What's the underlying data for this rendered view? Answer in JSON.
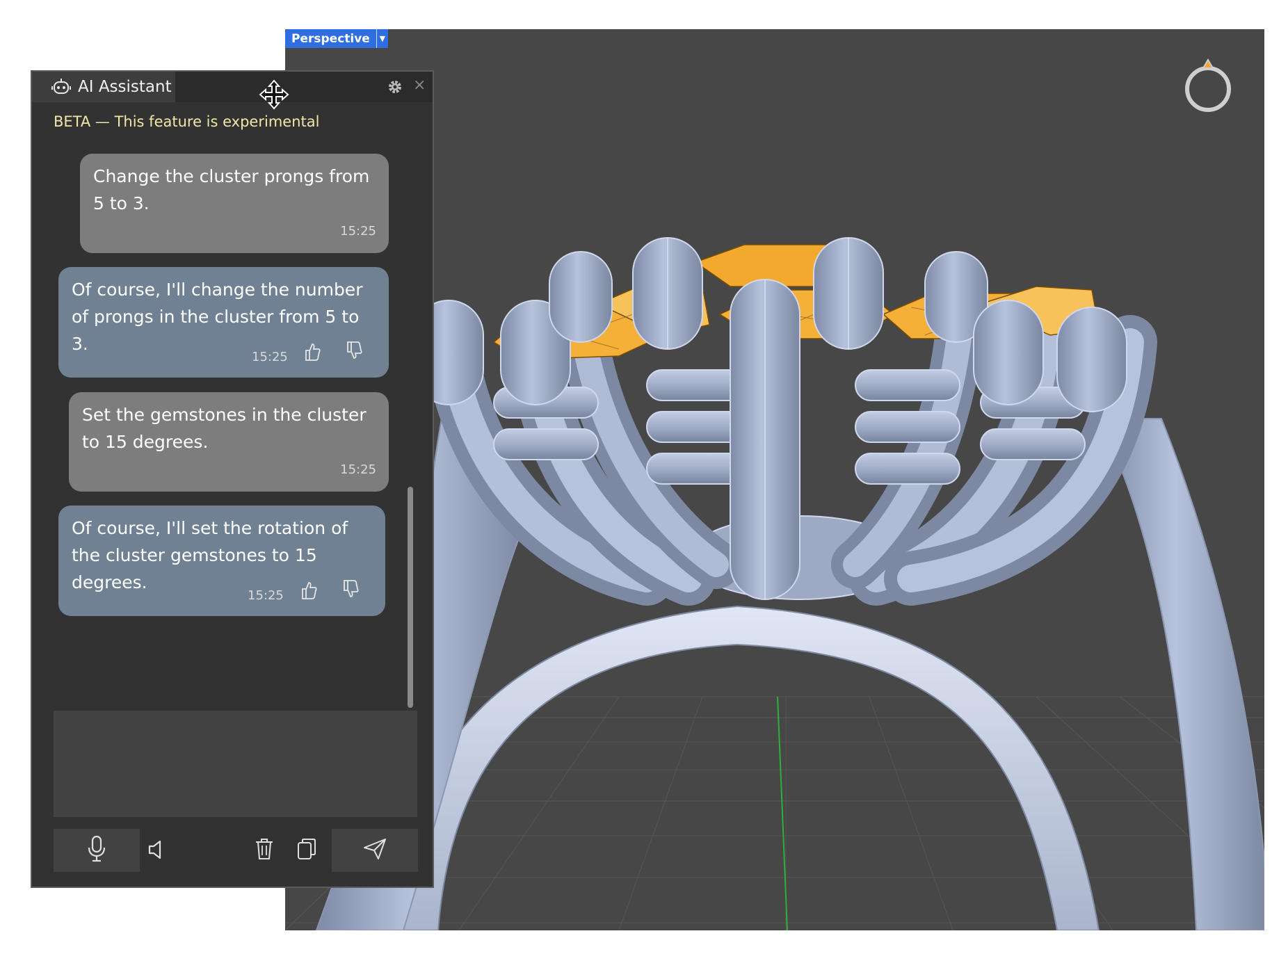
{
  "viewport": {
    "view_label": "Perspective"
  },
  "panel": {
    "tab_title": "AI Assistant",
    "beta_notice": "BETA — This feature is experimental",
    "messages": [
      {
        "role": "user",
        "text": "Change the cluster prongs from 5 to 3.",
        "time": "15:25"
      },
      {
        "role": "assistant",
        "text": "Of course, I'll change the number of prongs in the cluster from 5 to 3.",
        "time": "15:25"
      },
      {
        "role": "user",
        "text": "Set the gemstones in the cluster to 15 degrees.",
        "time": "15:25"
      },
      {
        "role": "assistant",
        "text": "Of course, I'll set the rotation of the cluster gemstones to 15 degrees.",
        "time": "15:25"
      }
    ],
    "input_value": ""
  },
  "colors": {
    "viewport_bg": "#474747",
    "metal": "#a9b5cf",
    "gem": "#f5b03a",
    "accent": "#2f6ee0"
  }
}
